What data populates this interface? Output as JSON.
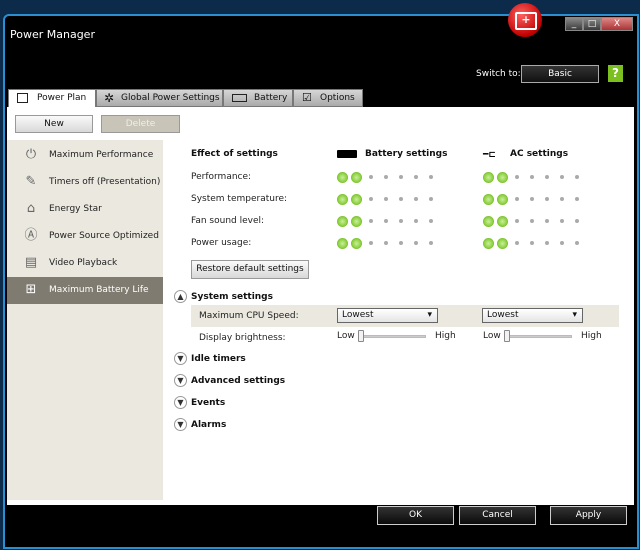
{
  "window": {
    "title": "Power Manager",
    "minimize": "_",
    "maximize": "□",
    "close": "X"
  },
  "header": {
    "switch_label": "Switch to:",
    "basic_button": "Basic",
    "help": "?"
  },
  "tabs": [
    {
      "label": "Power Plan",
      "icon": "page-icon"
    },
    {
      "label": "Global Power Settings",
      "icon": "gear-icon"
    },
    {
      "label": "Battery",
      "icon": "battery-icon"
    },
    {
      "label": "Options",
      "icon": "checkbox-icon"
    }
  ],
  "toolbar": {
    "new": "New",
    "delete": "Delete"
  },
  "plans": [
    {
      "label": "Maximum Performance",
      "icon": "power-icon",
      "glyph": "⏻"
    },
    {
      "label": "Timers off (Presentation)",
      "icon": "projector-icon",
      "glyph": "✎"
    },
    {
      "label": "Energy Star",
      "icon": "house-icon",
      "glyph": "⌂"
    },
    {
      "label": "Power Source Optimized",
      "icon": "auto-icon",
      "glyph": "Ⓐ"
    },
    {
      "label": "Video Playback",
      "icon": "film-icon",
      "glyph": "▤"
    },
    {
      "label": "Maximum Battery Life",
      "icon": "battery-clock-icon",
      "glyph": "⊞",
      "selected": true
    }
  ],
  "effect": {
    "title": "Effect of settings",
    "battery_header": "Battery settings",
    "ac_header": "AC settings",
    "rows": [
      {
        "label": "Performance:",
        "battery_level": 2,
        "ac_level": 2
      },
      {
        "label": "System temperature:",
        "battery_level": 2,
        "ac_level": 2
      },
      {
        "label": "Fan sound level:",
        "battery_level": 2,
        "ac_level": 2
      },
      {
        "label": "Power usage:",
        "battery_level": 2,
        "ac_level": 2
      }
    ],
    "max_level": 7,
    "restore": "Restore default settings"
  },
  "system_settings": {
    "title": "System settings",
    "cpu_label": "Maximum CPU Speed:",
    "cpu_battery": "Lowest",
    "cpu_ac": "Lowest",
    "brightness_label": "Display brightness:",
    "low": "Low",
    "high": "High",
    "brightness_battery": 0,
    "brightness_ac": 0
  },
  "sections": [
    "Idle timers",
    "Advanced settings",
    "Events",
    "Alarms"
  ],
  "dialog": {
    "ok": "OK",
    "cancel": "Cancel",
    "apply": "Apply"
  },
  "colors": {
    "accent_green": "#8fd040",
    "sidebar": "#ebe8e0",
    "selected": "#807b70",
    "border": "#2a8fd0"
  }
}
